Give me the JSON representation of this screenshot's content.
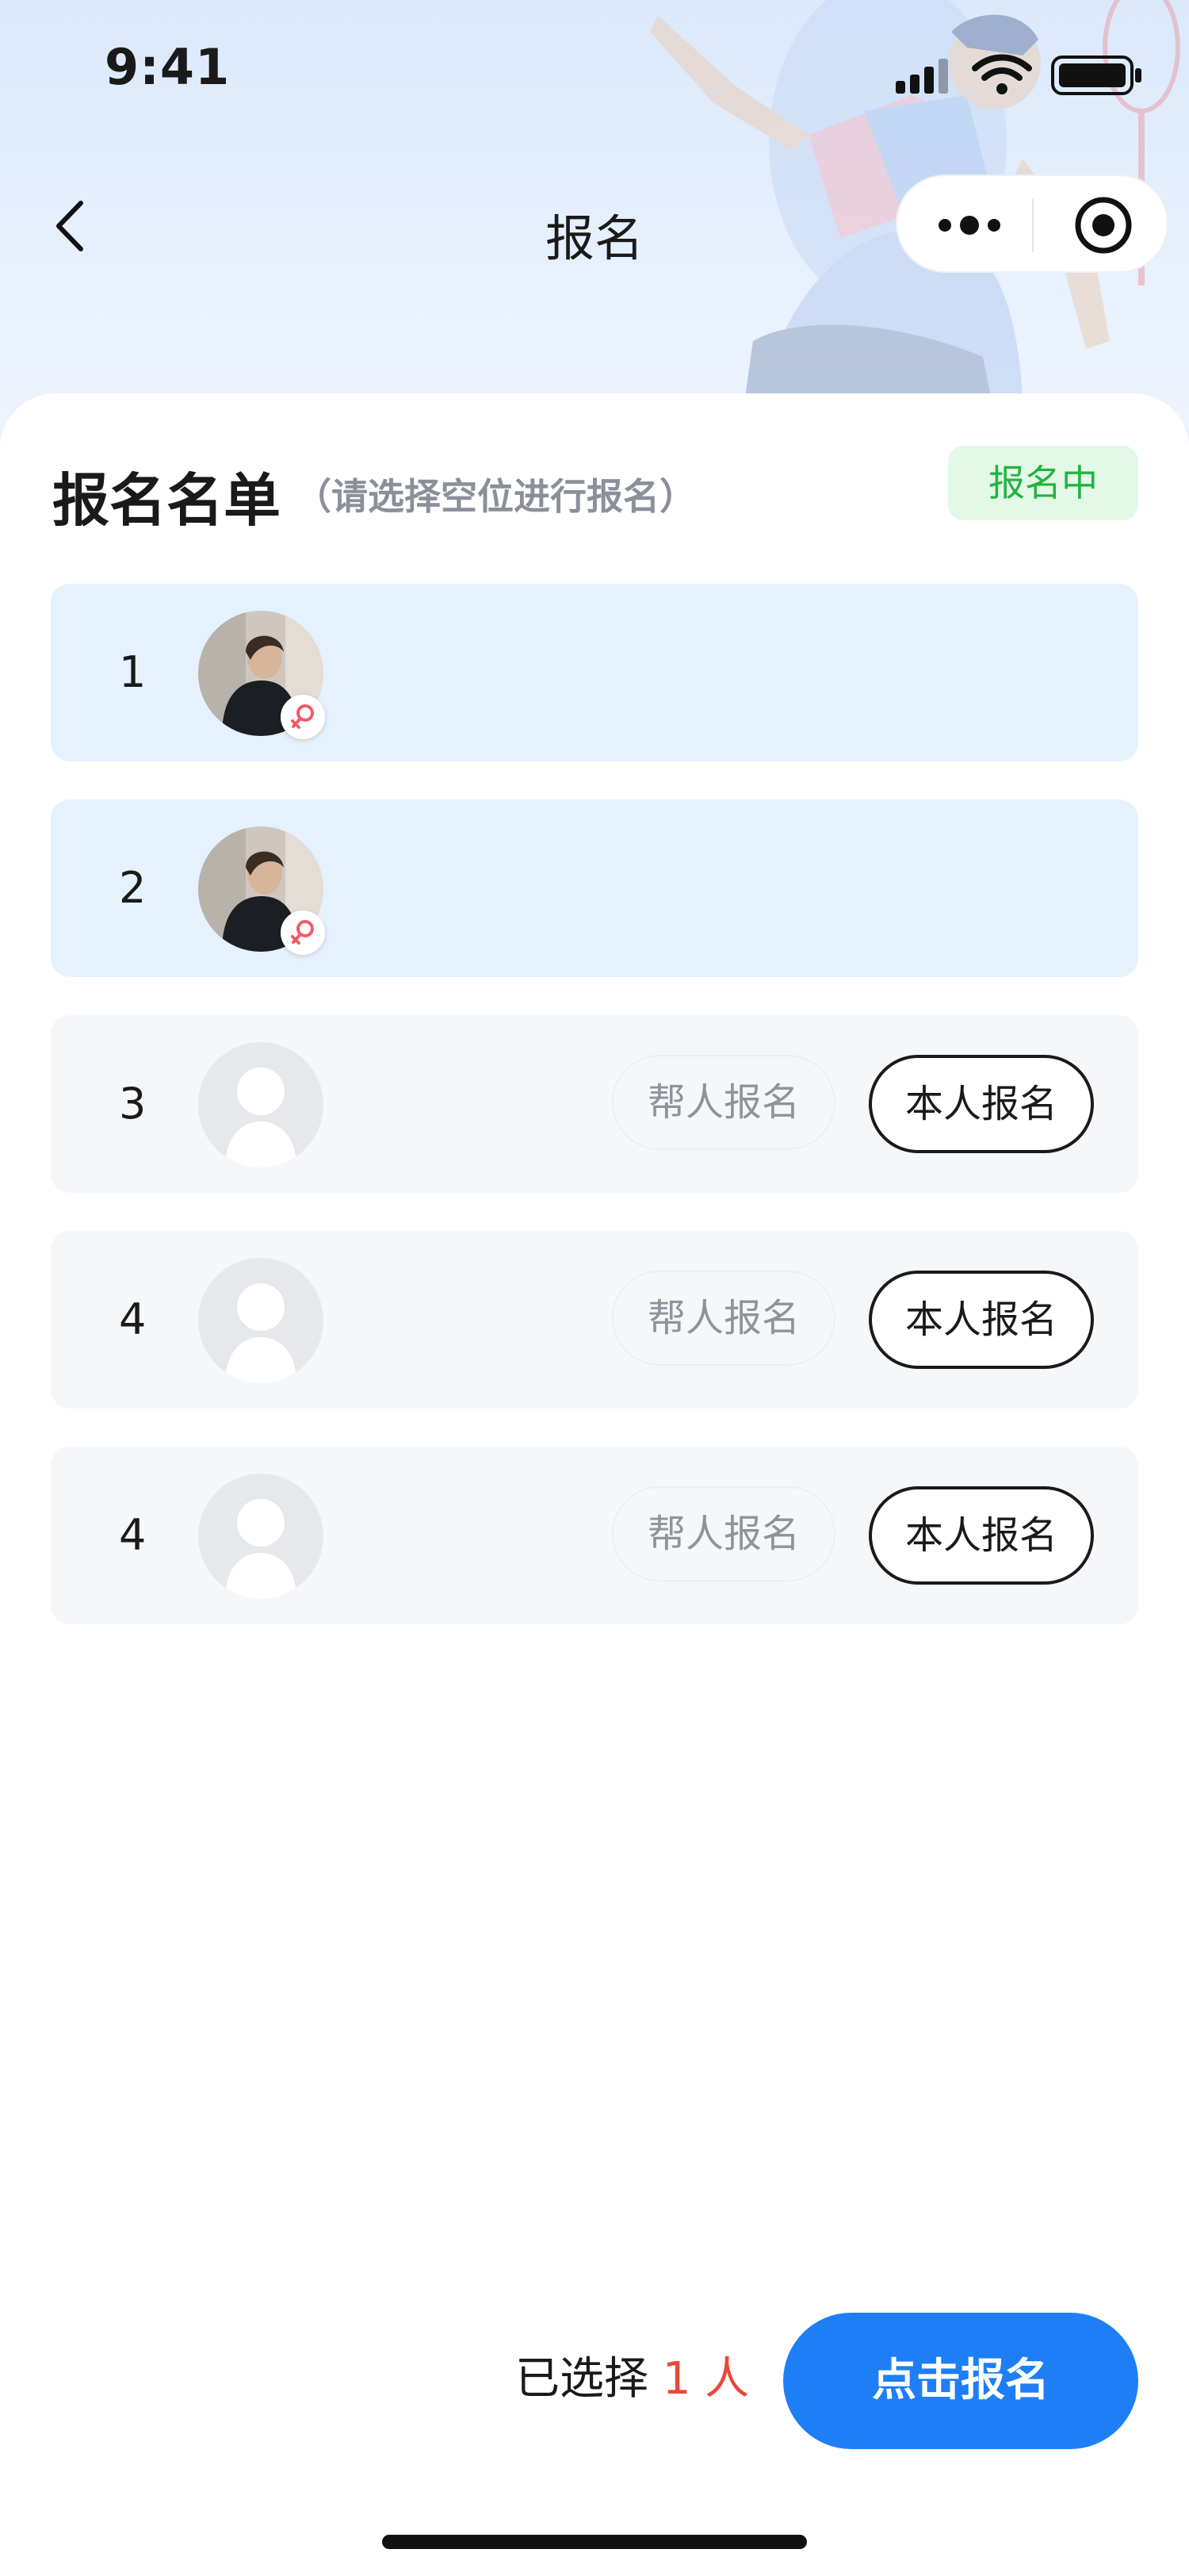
{
  "status_bar": {
    "time": "9:41"
  },
  "nav": {
    "title": "报名"
  },
  "section": {
    "title": "报名名单",
    "subtitle": "（请选择空位进行报名）",
    "badge": "报名中"
  },
  "rows": [
    {
      "index": "1",
      "state": "filled",
      "gender": "female"
    },
    {
      "index": "2",
      "state": "filled",
      "gender": "female"
    },
    {
      "index": "3",
      "state": "empty",
      "help_label": "帮人报名",
      "self_label": "本人报名"
    },
    {
      "index": "4",
      "state": "empty",
      "help_label": "帮人报名",
      "self_label": "本人报名"
    },
    {
      "index": "4",
      "state": "empty",
      "help_label": "帮人报名",
      "self_label": "本人报名"
    }
  ],
  "footer": {
    "selected_prefix": "已选择",
    "selected_count": "1",
    "selected_suffix": "人",
    "submit_label": "点击报名"
  },
  "colors": {
    "primary": "#1e7ef6",
    "badge_bg": "#e3f8e6",
    "badge_text": "#23b341",
    "filled_row": "#e5f2fe",
    "empty_row": "#f6f7f9",
    "count": "#e9473a"
  }
}
